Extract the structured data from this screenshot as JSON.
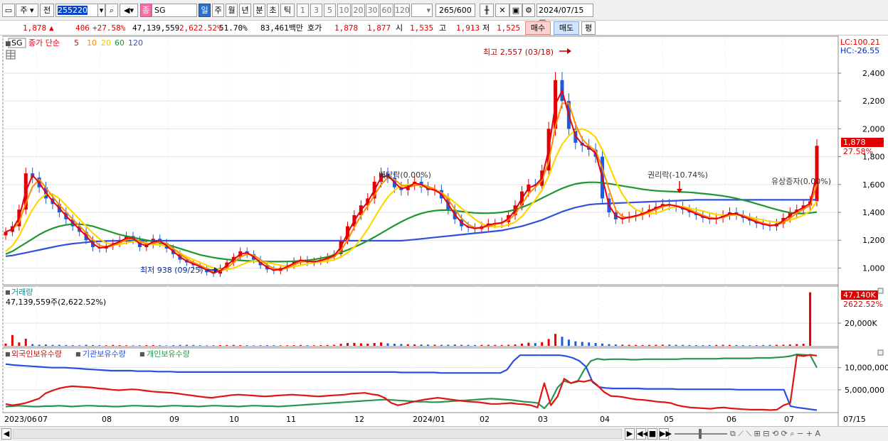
{
  "toolbar": {
    "period_label": "주",
    "jeon_label": "전",
    "code_value": "255220",
    "type_label": "종",
    "name_value": "SG",
    "tabs": [
      "일",
      "주",
      "월",
      "년",
      "분",
      "초",
      "틱"
    ],
    "intervals": [
      "1",
      "3",
      "5",
      "10",
      "20",
      "30",
      "60",
      "120"
    ],
    "count_value": "265",
    "count_total": "/600",
    "date_value": "2024/07/15"
  },
  "quote": {
    "price": "1,878",
    "arrow": "▲",
    "change": "406",
    "change_pct": "+27.58%",
    "volume": "47,139,559",
    "volume_pct": "2,622.52%",
    "turnover": "51.70%",
    "amount": "83,461백만",
    "hoga_label": "호가",
    "ask": "1,878",
    "bid": "1,877",
    "open_label": "시",
    "open": "1,535",
    "high_label": "고",
    "high": "1,913",
    "low_label": "저",
    "low": "1,525",
    "buy_label": "매수",
    "sell_label": "매도",
    "eval_label": "평"
  },
  "price_panel": {
    "stock_tag": "SG",
    "legend_title": "종가 단순",
    "ma_labels": [
      "5",
      "10",
      "20",
      "60",
      "120"
    ],
    "lc_label": "LC:100.21",
    "hc_label": "HC:-26.55",
    "current_price_tag": "1,878",
    "current_pct_tag": "27.58%",
    "annotations": {
      "high": "최고 2,557 (03/18)",
      "low": "최저 938 (09/25)",
      "dividend": "배당락(0.00%)",
      "rights": "권리락(-10.74%)",
      "capital_increase": "유상증자(0.00%)"
    }
  },
  "volume_panel": {
    "title": "거래량",
    "value_text": "47,139,559주(2,622.52%)",
    "tag_value": "47,140K",
    "tag_pct": "2622.52%"
  },
  "holdings_panel": {
    "legend": [
      "외국인보유수량",
      "기관보유수량",
      "개인보유수량"
    ]
  },
  "x_axis": {
    "labels": [
      "2023/06",
      "07",
      "08",
      "09",
      "10",
      "11",
      "12",
      "2024/01",
      "02",
      "03",
      "04",
      "05",
      "06",
      "07",
      "07/15"
    ]
  },
  "colors": {
    "up": "#e00000",
    "down": "#1e5adc",
    "ma5": "#e60012",
    "ma10": "#ff8c00",
    "ma20": "#ffd700",
    "ma60": "#1e9632",
    "ma120": "#3250dc",
    "foreign": "#e01414",
    "institution": "#2850dc",
    "individual": "#289650"
  },
  "chart_data": [
    {
      "type": "candlestick",
      "title": "SG",
      "y_ticks": [
        1000,
        1200,
        1400,
        1600,
        1800,
        2000,
        2200,
        2400
      ],
      "ylim": [
        885,
        2660
      ],
      "x_categories": [
        "2023/06",
        "07",
        "08",
        "09",
        "10",
        "11",
        "12",
        "2024/01",
        "02",
        "03",
        "04",
        "05",
        "06",
        "07"
      ],
      "close_series": [
        1260,
        1300,
        1420,
        1680,
        1650,
        1580,
        1500,
        1460,
        1400,
        1350,
        1300,
        1260,
        1200,
        1150,
        1140,
        1160,
        1180,
        1200,
        1230,
        1200,
        1150,
        1170,
        1210,
        1180,
        1140,
        1100,
        1060,
        1040,
        1020,
        1000,
        970,
        960,
        1000,
        1040,
        1080,
        1120,
        1100,
        1060,
        1020,
        990,
        980,
        1000,
        1020,
        1050,
        1060,
        1040,
        1050,
        1060,
        1080,
        1100,
        1200,
        1300,
        1380,
        1450,
        1500,
        1620,
        1680,
        1650,
        1580,
        1560,
        1600,
        1620,
        1580,
        1560,
        1560,
        1500,
        1420,
        1350,
        1300,
        1290,
        1280,
        1300,
        1320,
        1320,
        1330,
        1380,
        1450,
        1550,
        1600,
        1590,
        1700,
        2000,
        2350,
        2200,
        2000,
        1900,
        1880,
        1850,
        1800,
        1500,
        1400,
        1350,
        1360,
        1370,
        1380,
        1400,
        1420,
        1440,
        1460,
        1450,
        1440,
        1420,
        1400,
        1380,
        1360,
        1350,
        1360,
        1380,
        1400,
        1380,
        1360,
        1340,
        1320,
        1310,
        1300,
        1320,
        1360,
        1400,
        1420,
        1450,
        1480,
        1878
      ],
      "ma20_series": [
        1120,
        1160,
        1230,
        1330,
        1420,
        1490,
        1530,
        1530,
        1500,
        1450,
        1400,
        1350,
        1300,
        1250,
        1210,
        1180,
        1170,
        1170,
        1180,
        1190,
        1190,
        1180,
        1170,
        1165,
        1160,
        1140,
        1110,
        1080,
        1060,
        1040,
        1020,
        1000,
        990,
        990,
        1000,
        1020,
        1040,
        1050,
        1050,
        1040,
        1030,
        1020,
        1010,
        1010,
        1020,
        1030,
        1040,
        1045,
        1050,
        1060,
        1080,
        1110,
        1150,
        1210,
        1280,
        1360,
        1440,
        1510,
        1560,
        1590,
        1600,
        1600,
        1590,
        1580,
        1560,
        1540,
        1510,
        1470,
        1430,
        1390,
        1350,
        1320,
        1300,
        1295,
        1300,
        1310,
        1330,
        1370,
        1430,
        1490,
        1560,
        1660,
        1790,
        1890,
        1950,
        1990,
        2000,
        1980,
        1940,
        1850,
        1740,
        1620,
        1530,
        1460,
        1420,
        1400,
        1390,
        1395,
        1410,
        1430,
        1440,
        1440,
        1430,
        1420,
        1410,
        1395,
        1385,
        1380,
        1380,
        1380,
        1375,
        1365,
        1355,
        1345,
        1335,
        1330,
        1335,
        1345,
        1360,
        1380,
        1410,
        1480
      ],
      "ma60_series": [
        1100,
        1120,
        1150,
        1180,
        1210,
        1240,
        1265,
        1285,
        1300,
        1310,
        1315,
        1315,
        1310,
        1300,
        1285,
        1270,
        1255,
        1240,
        1230,
        1220,
        1210,
        1200,
        1190,
        1180,
        1170,
        1155,
        1140,
        1125,
        1110,
        1095,
        1085,
        1075,
        1068,
        1062,
        1058,
        1055,
        1052,
        1050,
        1048,
        1047,
        1046,
        1046,
        1047,
        1049,
        1052,
        1056,
        1062,
        1070,
        1080,
        1095,
        1112,
        1130,
        1150,
        1172,
        1196,
        1222,
        1250,
        1278,
        1306,
        1332,
        1356,
        1376,
        1392,
        1404,
        1412,
        1416,
        1416,
        1412,
        1406,
        1400,
        1396,
        1394,
        1394,
        1396,
        1400,
        1408,
        1420,
        1436,
        1456,
        1478,
        1502,
        1526,
        1550,
        1572,
        1590,
        1604,
        1612,
        1616,
        1616,
        1612,
        1606,
        1598,
        1590,
        1582,
        1574,
        1566,
        1560,
        1555,
        1552,
        1550,
        1548,
        1546,
        1544,
        1540,
        1535,
        1530,
        1524,
        1518,
        1510,
        1500,
        1488,
        1476,
        1462,
        1448,
        1434,
        1420,
        1408,
        1398,
        1392,
        1392,
        1396,
        1402
      ],
      "ma120_series": [
        1085,
        1090,
        1100,
        1110,
        1120,
        1130,
        1140,
        1150,
        1160,
        1168,
        1175,
        1180,
        1185,
        1190,
        1192,
        1194,
        1195,
        1196,
        1196,
        1196,
        1196,
        1196,
        1196,
        1196,
        1196,
        1196,
        1196,
        1196,
        1196,
        1196,
        1196,
        1196,
        1196,
        1196,
        1196,
        1196,
        1196,
        1196,
        1196,
        1196,
        1196,
        1196,
        1196,
        1196,
        1196,
        1196,
        1196,
        1196,
        1196,
        1196,
        1196,
        1196,
        1196,
        1196,
        1196,
        1196,
        1196,
        1196,
        1196,
        1196,
        1200,
        1205,
        1210,
        1215,
        1220,
        1225,
        1230,
        1235,
        1240,
        1245,
        1250,
        1255,
        1260,
        1265,
        1270,
        1280,
        1290,
        1300,
        1315,
        1330,
        1345,
        1365,
        1385,
        1405,
        1420,
        1435,
        1445,
        1455,
        1460,
        1462,
        1464,
        1466,
        1468,
        1470,
        1472,
        1474,
        1476,
        1478,
        1480,
        1482,
        1484,
        1486,
        1488,
        1490,
        1490,
        1490,
        1490,
        1490,
        1490,
        1490,
        1490,
        1490,
        1490,
        1490,
        1490,
        1490,
        1490,
        1490,
        1490,
        1490,
        1490,
        1490
      ]
    },
    {
      "type": "bar",
      "title": "거래량",
      "y_ticks": [
        20000
      ],
      "y_tick_labels": [
        "20,000K"
      ],
      "ylim": [
        0,
        50000
      ],
      "values": [
        2000,
        9500,
        3000,
        6200,
        1500,
        1000,
        1200,
        800,
        900,
        700,
        600,
        500,
        900,
        700,
        600,
        500,
        800,
        600,
        500,
        400,
        500,
        600,
        700,
        500,
        400,
        600,
        800,
        900,
        700,
        500,
        400,
        500,
        600,
        700,
        800,
        600,
        500,
        400,
        500,
        600,
        500,
        400,
        500,
        600,
        700,
        500,
        500,
        600,
        700,
        900,
        1800,
        2500,
        2600,
        2200,
        1900,
        2500,
        3000,
        2200,
        1800,
        1600,
        1400,
        1300,
        1200,
        1100,
        1000,
        900,
        1000,
        1200,
        900,
        800,
        700,
        800,
        900,
        800,
        700,
        900,
        1200,
        2000,
        2800,
        2400,
        3200,
        6000,
        10500,
        8000,
        5500,
        4000,
        3500,
        3000,
        2500,
        2000,
        1500,
        1200,
        1000,
        900,
        800,
        700,
        800,
        900,
        1000,
        1100,
        900,
        800,
        700,
        600,
        600,
        700,
        800,
        900,
        800,
        700,
        600,
        500,
        600,
        700,
        800,
        900,
        1000,
        1200,
        1500,
        1800,
        47140
      ]
    },
    {
      "type": "line",
      "title": "외국인보유수량 기관보유수량 개인보유수량",
      "y_ticks": [
        5000000,
        10000000
      ],
      "y_tick_labels": [
        "5,000,000",
        "10,000,000"
      ],
      "ylim": [
        0,
        13800000
      ],
      "series": [
        {
          "name": "외국인보유수량",
          "values": [
            1800000,
            1500000,
            1700000,
            2000000,
            2500000,
            3000000,
            4200000,
            4800000,
            5300000,
            5600000,
            5800000,
            5700000,
            5600000,
            5500000,
            5300000,
            5200000,
            5000000,
            4900000,
            5000000,
            5100000,
            5000000,
            4800000,
            4600000,
            4500000,
            4400000,
            4300000,
            4100000,
            3900000,
            3700000,
            3500000,
            3300000,
            3200000,
            3400000,
            3600000,
            3800000,
            3900000,
            3800000,
            3700000,
            3600000,
            3500000,
            3600000,
            3700000,
            3800000,
            3900000,
            3800000,
            3700000,
            3600000,
            3500000,
            3600000,
            3700000,
            3800000,
            3900000,
            4100000,
            4200000,
            4300000,
            4000000,
            3800000,
            3200000,
            2000000,
            1500000,
            1800000,
            2200000,
            2500000,
            2800000,
            3000000,
            3200000,
            3000000,
            2800000,
            2600000,
            2400000,
            2300000,
            2200000,
            2000000,
            1800000,
            1800000,
            1900000,
            2000000,
            1800000,
            1700000,
            1500000,
            1000000,
            6500000,
            1500000,
            3500000,
            7500000,
            6500000,
            7000000,
            6800000,
            7200000,
            6000000,
            4500000,
            3600000,
            3500000,
            3300000,
            3000000,
            2800000,
            2700000,
            2500000,
            2300000,
            2200000,
            2000000,
            1500000,
            1200000,
            1000000,
            900000,
            800000,
            700000,
            900000,
            1000000,
            800000,
            700000,
            600000,
            500000,
            500000,
            500000,
            400000,
            500000,
            1500000,
            2000000,
            12800000,
            12600000,
            12900000,
            12700000
          ]
        },
        {
          "name": "기관보유수량",
          "values": [
            10800000,
            10600000,
            10500000,
            10400000,
            10300000,
            10200000,
            10100000,
            10000000,
            10000000,
            10000000,
            9900000,
            9800000,
            9700000,
            9600000,
            9500000,
            9400000,
            9300000,
            9300000,
            9300000,
            9300000,
            9200000,
            9200000,
            9200000,
            9100000,
            9100000,
            9100000,
            9000000,
            9000000,
            9000000,
            9000000,
            9000000,
            9000000,
            9000000,
            9000000,
            9000000,
            9000000,
            9000000,
            9000000,
            9000000,
            9000000,
            9000000,
            9000000,
            9000000,
            9000000,
            9000000,
            9000000,
            9000000,
            9000000,
            9000000,
            9000000,
            9000000,
            9000000,
            9000000,
            9000000,
            9000000,
            9000000,
            9000000,
            9000000,
            9000000,
            9000000,
            8900000,
            8900000,
            8900000,
            8900000,
            8900000,
            8900000,
            8800000,
            8800000,
            8800000,
            8800000,
            8800000,
            8800000,
            8800000,
            8800000,
            8800000,
            8800000,
            9500000,
            11500000,
            12800000,
            12800000,
            12800000,
            12800000,
            12800000,
            12800000,
            12800000,
            12600000,
            12200000,
            11500000,
            10200000,
            6700000,
            5600000,
            5400000,
            5300000,
            5300000,
            5300000,
            5300000,
            5300000,
            5200000,
            5200000,
            5200000,
            5200000,
            5200000,
            5100000,
            5100000,
            5100000,
            5100000,
            5100000,
            5100000,
            5100000,
            5100000,
            5100000,
            5000000,
            5000000,
            5000000,
            5000000,
            5000000,
            5000000,
            5000000,
            5000000,
            1300000,
            1000000,
            800000,
            600000,
            400000
          ]
        },
        {
          "name": "개인보유수량",
          "values": [
            1200000,
            1300000,
            1400000,
            1300000,
            1200000,
            1200000,
            1300000,
            1300000,
            1400000,
            1300000,
            1200000,
            1300000,
            1400000,
            1400000,
            1300000,
            1300000,
            1200000,
            1200000,
            1300000,
            1400000,
            1400000,
            1300000,
            1300000,
            1200000,
            1300000,
            1400000,
            1400000,
            1300000,
            1300000,
            1200000,
            1300000,
            1400000,
            1400000,
            1300000,
            1300000,
            1200000,
            1300000,
            1400000,
            1400000,
            1300000,
            1300000,
            1200000,
            1300000,
            1400000,
            1500000,
            1600000,
            1700000,
            1800000,
            1900000,
            2000000,
            2100000,
            2200000,
            2300000,
            2400000,
            2500000,
            2600000,
            2700000,
            2800000,
            2700000,
            2600000,
            2500000,
            2400000,
            2300000,
            2300000,
            2200000,
            2200000,
            2300000,
            2400000,
            2500000,
            2600000,
            2700000,
            2800000,
            2900000,
            3000000,
            2900000,
            2800000,
            2700000,
            2500000,
            2300000,
            2200000,
            2000000,
            800000,
            2500000,
            5500000,
            7000000,
            6500000,
            6800000,
            9500000,
            11500000,
            12000000,
            11800000,
            11900000,
            11900000,
            11900000,
            11800000,
            11800000,
            11900000,
            11900000,
            11900000,
            11900000,
            11900000,
            11900000,
            12000000,
            12000000,
            12000000,
            12000000,
            12000000,
            12000000,
            12100000,
            12100000,
            12100000,
            12100000,
            12100000,
            12200000,
            12200000,
            12200000,
            12300000,
            12400000,
            12600000,
            13000000,
            12900000,
            12800000,
            10000000
          ]
        }
      ]
    }
  ]
}
